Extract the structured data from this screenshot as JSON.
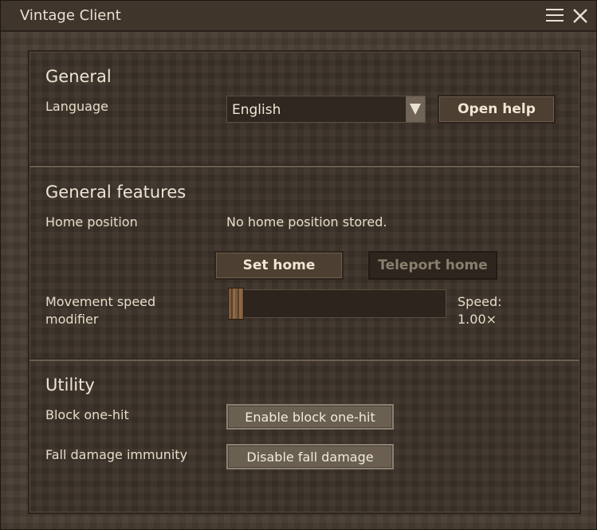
{
  "window": {
    "title": "Vintage Client"
  },
  "sections": {
    "general": {
      "heading": "General",
      "language_label": "Language",
      "language_value": "English",
      "open_help_label": "Open help"
    },
    "features": {
      "heading": "General features",
      "home_label": "Home position",
      "home_value": "No home position stored.",
      "set_home_label": "Set home",
      "teleport_home_label": "Teleport home",
      "speed_label_line1": "Movement speed",
      "speed_label_line2": "modifier",
      "speed_caption": "Speed:",
      "speed_value": "1.00×",
      "speed_slider_level": 0.0
    },
    "utility": {
      "heading": "Utility",
      "block_label": "Block one-hit",
      "block_button": "Enable block one-hit",
      "fall_label": "Fall damage immunity",
      "fall_button": "Disable fall damage"
    }
  },
  "icons": {
    "menu": "hamburger-icon",
    "close": "close-icon",
    "dropdown": "dropdown-arrow-icon"
  }
}
